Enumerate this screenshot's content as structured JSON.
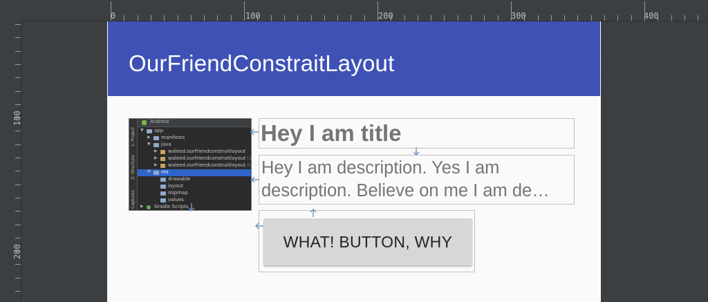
{
  "ruler": {
    "top_labels": [
      "0",
      "100",
      "200",
      "300",
      "400"
    ],
    "left_labels": [
      "100",
      "200"
    ]
  },
  "app": {
    "title": "OurFriendConstraitLayout",
    "colors": {
      "toolbar": "#3f51b5",
      "surface": "#fafafa",
      "editor_bg": "#3c3f41",
      "button": "#d6d7d7",
      "constraint": "#6f97c9"
    }
  },
  "image_view": {
    "tree_header": "Android",
    "side_tabs": [
      "1: Project",
      "Z: Structure",
      "Captures"
    ],
    "rows": [
      {
        "text": "app",
        "indent": 0,
        "kind": "folder",
        "selected": false
      },
      {
        "text": "manifests",
        "indent": 1,
        "kind": "folder",
        "selected": false
      },
      {
        "text": "java",
        "indent": 1,
        "kind": "folder",
        "selected": false
      },
      {
        "text": "waleed.ourfriendconstraitlayout",
        "indent": 2,
        "kind": "pkg",
        "selected": false,
        "suffix": ""
      },
      {
        "text": "waleed.ourfriendconstraitlayout",
        "indent": 2,
        "kind": "pkg",
        "selected": false,
        "suffix": "(androi"
      },
      {
        "text": "waleed.ourfriendconstraitlayout",
        "indent": 2,
        "kind": "pkg",
        "selected": false,
        "suffix": "(test)"
      },
      {
        "text": "res",
        "indent": 1,
        "kind": "folder",
        "selected": true
      },
      {
        "text": "drawable",
        "indent": 2,
        "kind": "folder",
        "selected": false
      },
      {
        "text": "layout",
        "indent": 2,
        "kind": "folder",
        "selected": false
      },
      {
        "text": "mipmap",
        "indent": 2,
        "kind": "folder",
        "selected": false
      },
      {
        "text": "values",
        "indent": 2,
        "kind": "folder",
        "selected": false
      },
      {
        "text": "Gradle Scripts",
        "indent": 0,
        "kind": "gradle",
        "selected": false
      }
    ]
  },
  "content": {
    "title": "Hey I am title",
    "description_line1": "Hey I am description. Yes I am",
    "description_line2": "description. Believe on me I am de…",
    "button_label": "WHAT! BUTTON, WHY"
  }
}
